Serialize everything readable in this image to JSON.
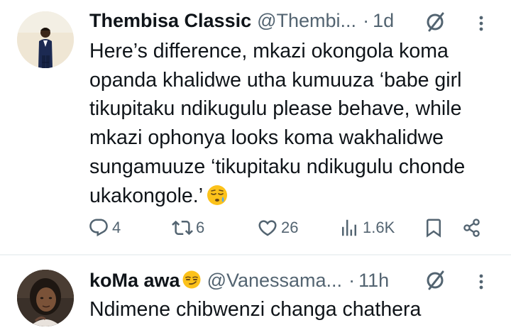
{
  "tweets": [
    {
      "display_name": "Thembisa Classic",
      "handle": "@Thembi...",
      "separator": "·",
      "time": "1d",
      "text": "Here’s difference, mkazi okongola koma opanda khalidwe utha kumuuza ‘babe girl tikupitaku ndikugulu please behave, while mkazi ophonya looks koma wakhalidwe sungamuuze ‘tikupitaku ndikugulu chonde ukakongole.’",
      "text_emoji": "sleepy-face-emoji",
      "actions": {
        "replies": "4",
        "retweets": "6",
        "likes": "26",
        "views": "1.6K"
      }
    },
    {
      "display_name": "koMa awa",
      "name_emoji": "smirking-face-emoji",
      "handle": "@Vanessama...",
      "separator": "·",
      "time": "11h",
      "text": "Ndimene chibwenzi changa chathera"
    }
  ],
  "colors": {
    "text": "#0f1419",
    "secondary": "#536471",
    "divider": "#eff3f4"
  }
}
